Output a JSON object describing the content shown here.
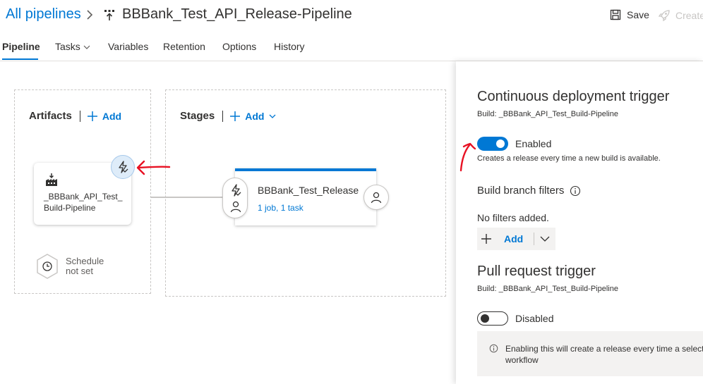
{
  "header": {
    "breadcrumb_root": "All pipelines",
    "pipeline_name": "BBBank_Test_API_Release-Pipeline",
    "save_label": "Save",
    "create_label": "Create"
  },
  "tabs": [
    {
      "label": "Pipeline",
      "active": true
    },
    {
      "label": "Tasks",
      "has_dropdown": true
    },
    {
      "label": "Variables"
    },
    {
      "label": "Retention"
    },
    {
      "label": "Options"
    },
    {
      "label": "History"
    }
  ],
  "artifacts": {
    "heading": "Artifacts",
    "add_label": "Add",
    "card_name": "_BBBank_API_Test_\nBuild-Pipeline",
    "schedule_line1": "Schedule",
    "schedule_line2": "not set"
  },
  "stages": {
    "heading": "Stages",
    "add_label": "Add",
    "stage_name": "BBBank_Test_Release",
    "stage_jobs": "1 job, 1 task"
  },
  "panel": {
    "cd_title": "Continuous deployment trigger",
    "cd_build": "Build: _BBBank_API_Test_Build-Pipeline",
    "cd_toggle_label": "Enabled",
    "cd_toggle_on": true,
    "cd_description": "Creates a release every time a new build is available.",
    "branch_filters_label": "Build branch filters",
    "no_filters_text": "No filters added.",
    "add_filter_label": "Add",
    "pr_title": "Pull request trigger",
    "pr_build": "Build: _BBBank_API_Test_Build-Pipeline",
    "pr_toggle_label": "Disabled",
    "pr_toggle_on": false,
    "pr_info_line1": "Enabling this will create a release every time a selecte",
    "pr_info_line2": "workflow"
  },
  "colors": {
    "accent": "#0078d4",
    "annotation": "#e81123",
    "disabled": "#c8c6c4"
  }
}
